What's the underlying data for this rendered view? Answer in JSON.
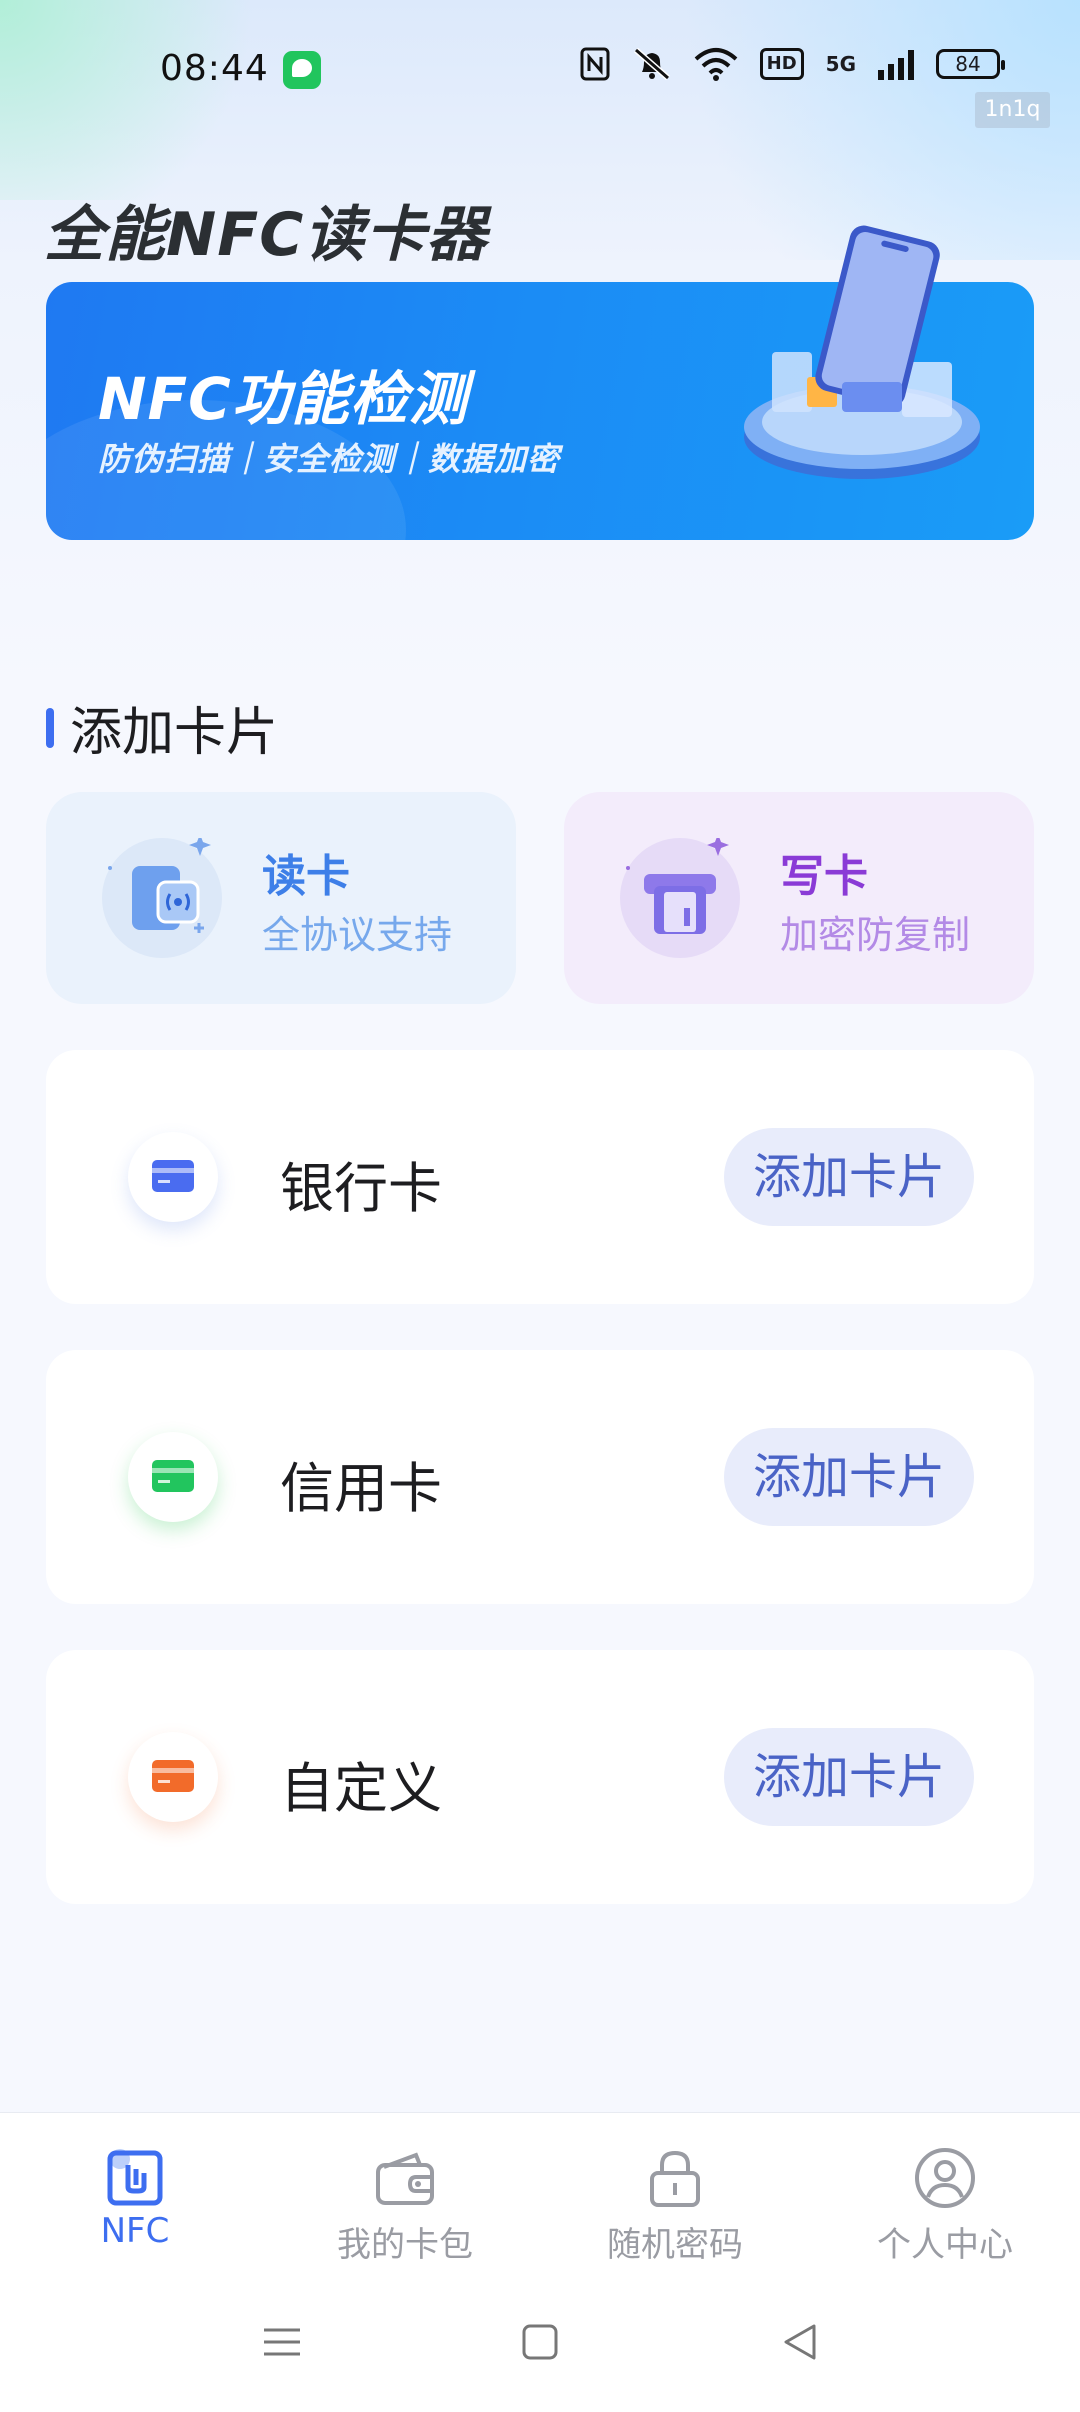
{
  "status_bar": {
    "time": "08:44",
    "hd_label": "HD",
    "network_label": "5G",
    "battery": "84",
    "watermark": "1n1q"
  },
  "header": {
    "title": "全能NFC读卡器"
  },
  "banner": {
    "title": "NFC功能检测",
    "subtitle": "防伪扫描｜安全检测｜数据加密"
  },
  "section": {
    "title": "添加卡片"
  },
  "features": {
    "read": {
      "title": "读卡",
      "subtitle": "全协议支持",
      "icon": "nfc-card-read-icon"
    },
    "write": {
      "title": "写卡",
      "subtitle": "加密防复制",
      "icon": "card-write-icon"
    }
  },
  "cards": [
    {
      "name": "银行卡",
      "button": "添加卡片",
      "icon": "bank-card-icon",
      "color": "#4a6cf0"
    },
    {
      "name": "信用卡",
      "button": "添加卡片",
      "icon": "credit-card-icon",
      "color": "#22c55e"
    },
    {
      "name": "自定义",
      "button": "添加卡片",
      "icon": "custom-card-icon",
      "color": "#f26b2a"
    }
  ],
  "bottom_nav": [
    {
      "label": "NFC",
      "icon": "nfc-icon",
      "active": true
    },
    {
      "label": "我的卡包",
      "icon": "wallet-icon",
      "active": false
    },
    {
      "label": "随机密码",
      "icon": "lock-icon",
      "active": false
    },
    {
      "label": "个人中心",
      "icon": "user-icon",
      "active": false
    }
  ],
  "colors": {
    "accent": "#3d6ef0",
    "banner": "#1f79f2",
    "button_bg": "#e8ecfb",
    "button_text": "#4a63c6"
  }
}
